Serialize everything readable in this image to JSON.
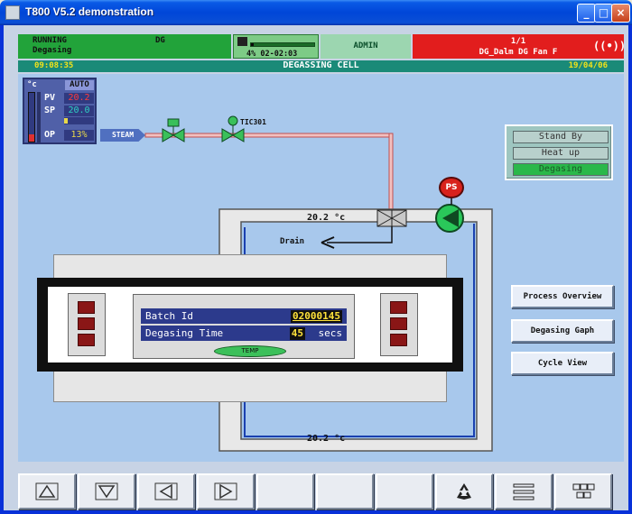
{
  "window": {
    "title": "T800 V5.2 demonstration",
    "min": "_",
    "max": "□",
    "close": "×"
  },
  "header": {
    "status": "RUNNING",
    "mode_short": "DG",
    "sub_status": "Degasing",
    "disk_percent": 4,
    "disk_text": "4% 02-02:03",
    "user": "ADMIN",
    "alarm_count": "1/1",
    "alarm_text": "DG_Dalm DG Fan F"
  },
  "titlebar": {
    "time": "09:08:35",
    "title": "DEGASSING CELL",
    "date": "19/04/06"
  },
  "controller": {
    "unit": "°c",
    "mode": "AUTO",
    "pv_label": "PV",
    "pv": "20.2",
    "sp_label": "SP",
    "sp": "20.0",
    "op_label": "OP",
    "op": "13%",
    "op_fraction": 0.13,
    "pv_color": "#ff3a3a",
    "sp_color": "#2ed1c4",
    "op_color": "#e8d84a"
  },
  "process": {
    "steam_label": "STEAM",
    "tic_label": "TIC301",
    "temp_top": "20.2 °c",
    "temp_bottom": "20.2 °c",
    "drain_label": "Drain",
    "pressure_switch": "PS"
  },
  "mode_panel": {
    "items": [
      {
        "label": "Stand By",
        "active": false
      },
      {
        "label": "Heat up",
        "active": false
      },
      {
        "label": "Degasing",
        "active": true
      }
    ]
  },
  "nav_buttons": [
    "Process Overview",
    "Degasing Gaph",
    "Cycle View"
  ],
  "cell": {
    "batch_label": "Batch Id",
    "batch_value": "02000145",
    "time_label": "Degasing Time",
    "time_value": "45",
    "time_unit": "secs",
    "temp_button": "TEMP"
  },
  "toolbar": {
    "keys": [
      "up-triangle-icon",
      "down-triangle-icon",
      "left-triangle-icon",
      "right-triangle-icon",
      "",
      "",
      "",
      "recycle-icon",
      "list-icon",
      "grid-icon"
    ]
  },
  "colors": {
    "running": "#22a33a",
    "alarm": "#e21d1d",
    "title_strip": "#1a8a78",
    "panel_bg": "#a8c8ec"
  }
}
